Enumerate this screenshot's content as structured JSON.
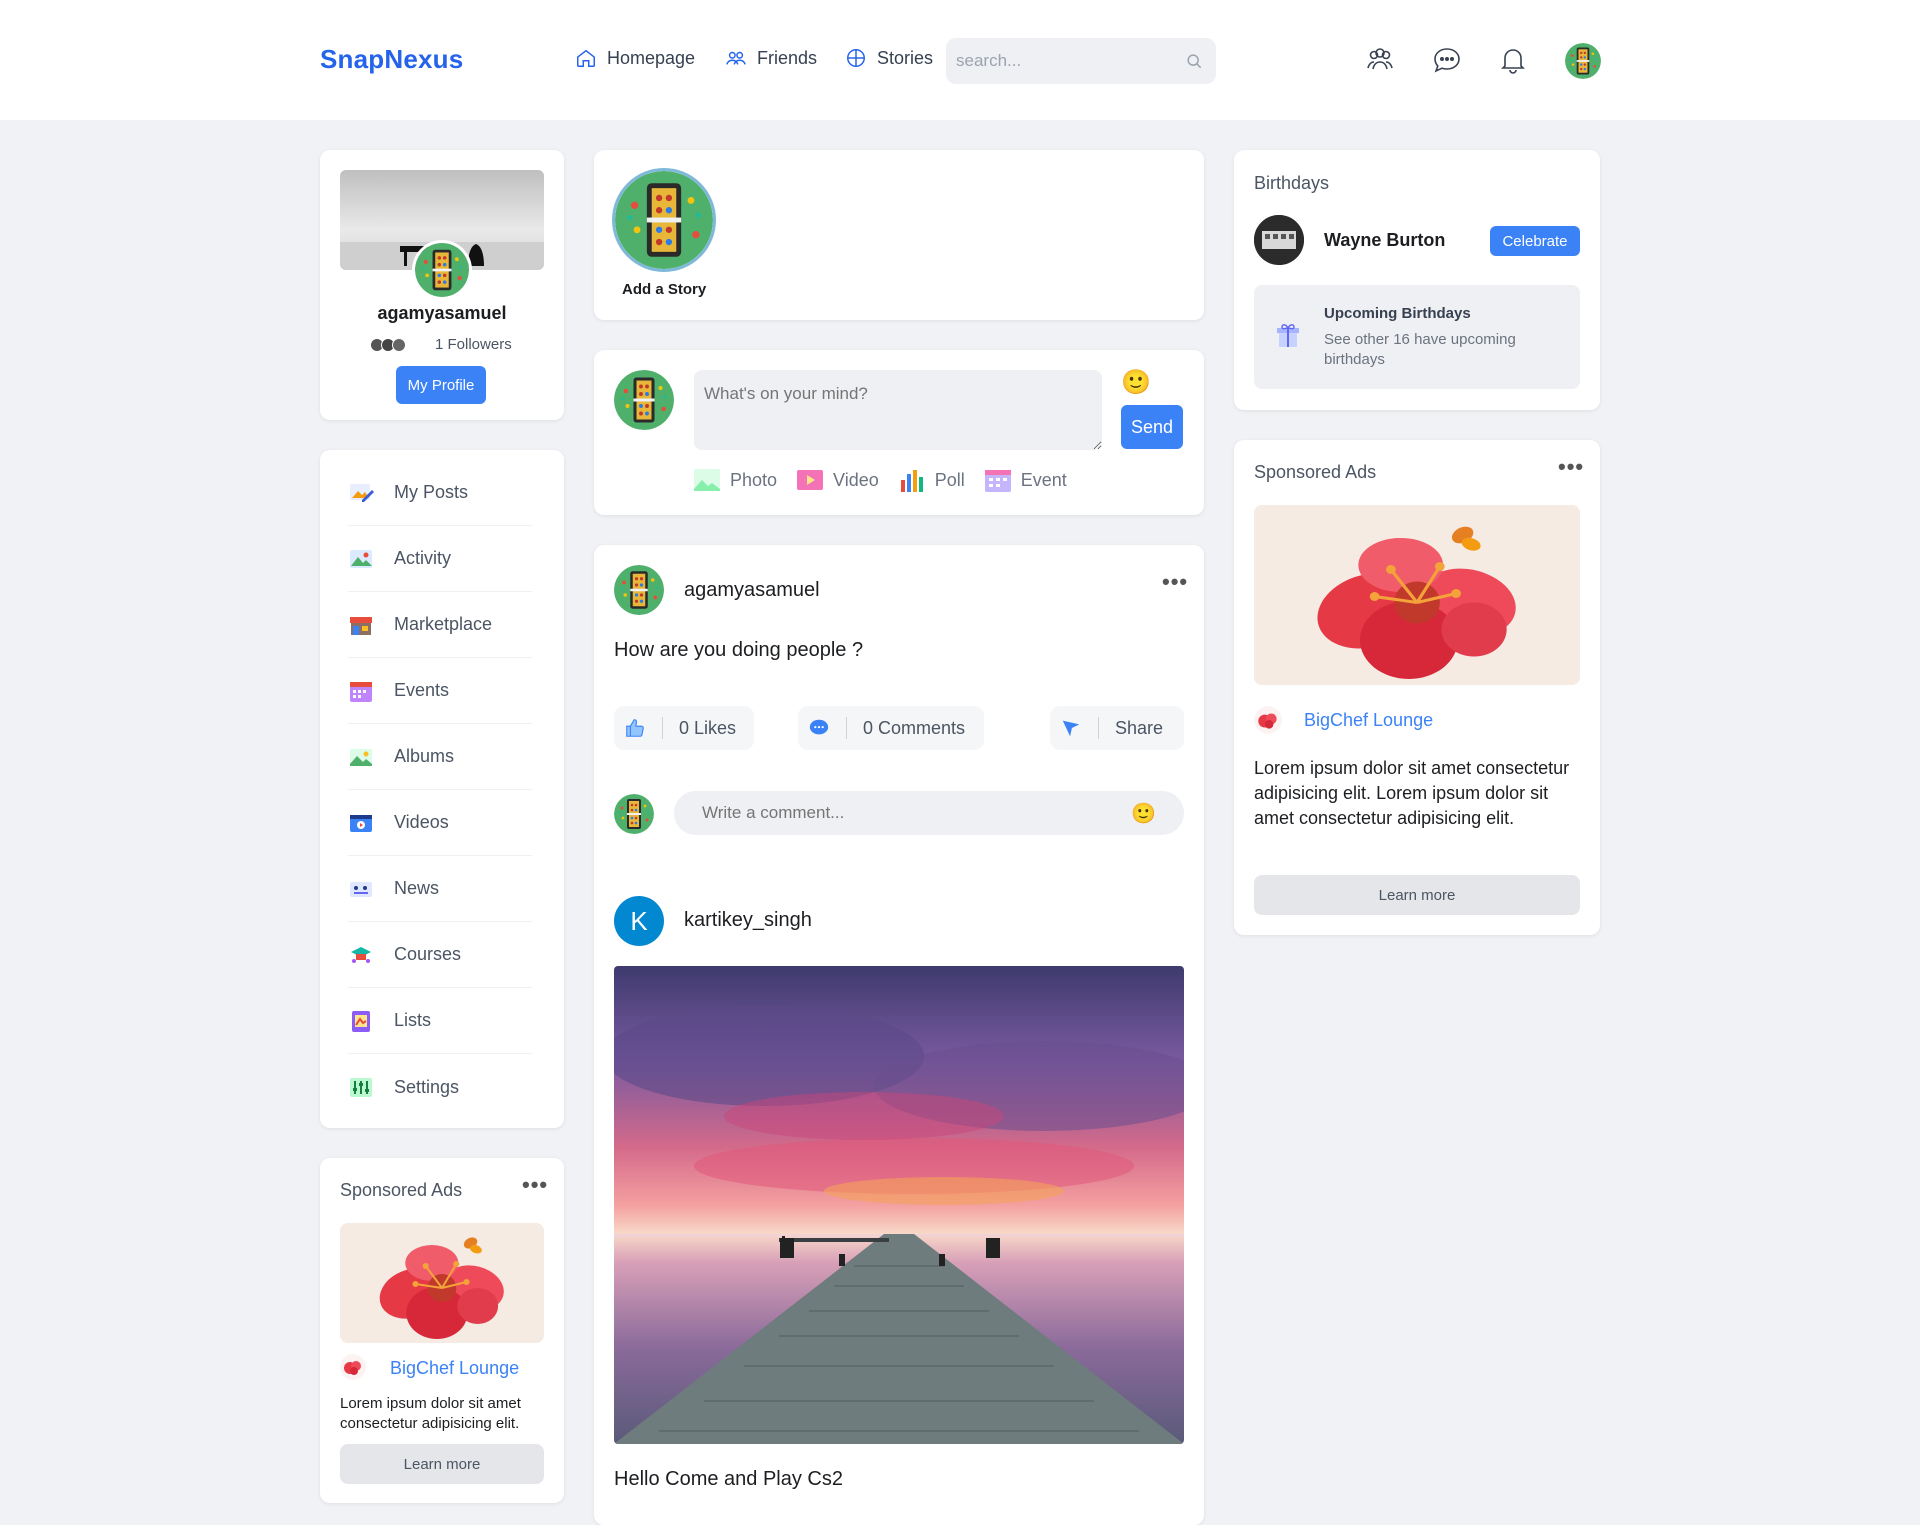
{
  "nav": {
    "logo": "SnapNexus",
    "links": [
      {
        "label": "Homepage",
        "icon": "home-icon"
      },
      {
        "label": "Friends",
        "icon": "friends-icon"
      },
      {
        "label": "Stories",
        "icon": "stories-icon"
      }
    ],
    "search_placeholder": "search...",
    "icons": [
      "people-icon",
      "chat-icon",
      "bell-icon"
    ]
  },
  "profile": {
    "username": "agamyasamuel",
    "followers": "1 Followers",
    "button": "My Profile"
  },
  "menu": [
    {
      "label": "My Posts",
      "icon": "posts-icon"
    },
    {
      "label": "Activity",
      "icon": "activity-icon"
    },
    {
      "label": "Marketplace",
      "icon": "marketplace-icon"
    },
    {
      "label": "Events",
      "icon": "events-icon"
    },
    {
      "label": "Albums",
      "icon": "albums-icon"
    },
    {
      "label": "Videos",
      "icon": "videos-icon"
    },
    {
      "label": "News",
      "icon": "news-icon"
    },
    {
      "label": "Courses",
      "icon": "courses-icon"
    },
    {
      "label": "Lists",
      "icon": "lists-icon"
    },
    {
      "label": "Settings",
      "icon": "settings-icon"
    }
  ],
  "left_ad": {
    "title": "Sponsored Ads",
    "brand": "BigChef Lounge",
    "text": "Lorem ipsum dolor sit amet consectetur adipisicing elit.",
    "button": "Learn more"
  },
  "stories": {
    "add_label": "Add a Story"
  },
  "composer": {
    "placeholder": "What's on your mind?",
    "send": "Send",
    "options": [
      {
        "label": "Photo",
        "icon": "photo-icon"
      },
      {
        "label": "Video",
        "icon": "video-icon"
      },
      {
        "label": "Poll",
        "icon": "poll-icon"
      },
      {
        "label": "Event",
        "icon": "event-icon"
      }
    ]
  },
  "post1": {
    "author": "agamyasamuel",
    "text": "How are you doing people ?",
    "likes": "0 Likes",
    "comments": "0 Comments",
    "share": "Share",
    "comment_placeholder": "Write a comment..."
  },
  "post2": {
    "author_initial": "K",
    "author": "kartikey_singh",
    "caption": "Hello Come and Play Cs2"
  },
  "birthdays": {
    "title": "Birthdays",
    "person": "Wayne Burton",
    "button": "Celebrate",
    "upcoming_title": "Upcoming Birthdays",
    "upcoming_text": "See other 16 have upcoming birthdays"
  },
  "right_ad": {
    "title": "Sponsored Ads",
    "brand": "BigChef Lounge",
    "text": "Lorem ipsum dolor sit amet consectetur adipisicing elit. Lorem ipsum dolor sit amet consectetur adipisicing elit.",
    "button": "Learn more"
  },
  "colors": {
    "brand": "#2563eb",
    "primary": "#3b82f6",
    "background": "#f0f2f5"
  }
}
